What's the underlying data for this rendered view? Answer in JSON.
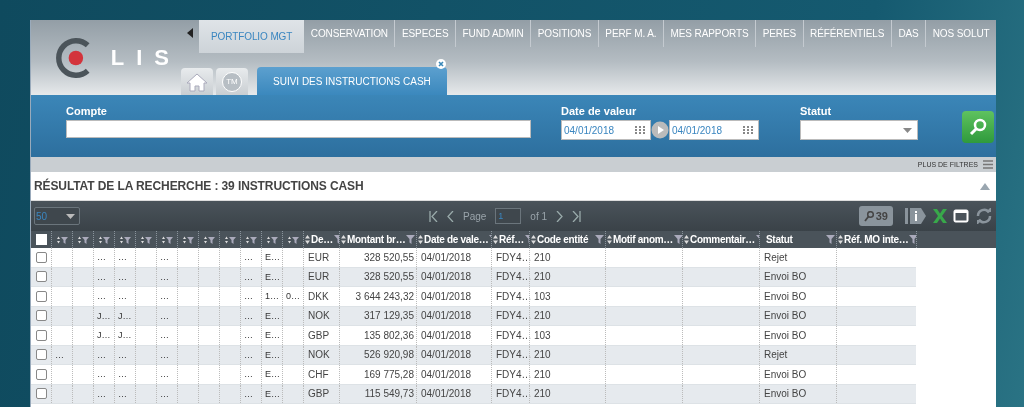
{
  "logo": "LIS",
  "nav": {
    "tabs": [
      {
        "label": "PORTFOLIO MGT",
        "selected": true
      },
      {
        "label": "CONSERVATION",
        "selected": false
      },
      {
        "label": "ESPECES",
        "selected": false
      },
      {
        "label": "FUND ADMIN",
        "selected": false
      },
      {
        "label": "POSITIONS",
        "selected": false
      },
      {
        "label": "PERF M. A.",
        "selected": false
      },
      {
        "label": "MES RAPPORTS",
        "selected": false
      },
      {
        "label": "PERES",
        "selected": false
      },
      {
        "label": "RÉFÉRENTIELS",
        "selected": false
      },
      {
        "label": "DAS",
        "selected": false
      },
      {
        "label": "NOS SOLUT",
        "selected": false
      }
    ]
  },
  "subtabs": [
    {
      "kind": "home",
      "selected": false
    },
    {
      "kind": "badge",
      "label": "TM",
      "selected": false
    },
    {
      "kind": "text",
      "label": "SUIVI DES INSTRUCTIONS CASH",
      "selected": true,
      "closable": true
    }
  ],
  "search_panel": {
    "fields": [
      {
        "kind": "text",
        "label": "Compte"
      },
      {
        "kind": "date_range",
        "label": "Date de valeur",
        "from": "04/01/2018",
        "to": "04/01/2018"
      },
      {
        "kind": "select",
        "label": "Statut"
      }
    ]
  },
  "filter_bar": {
    "link": "PLUS DE FILTRES"
  },
  "results": {
    "title": "RÉSULTAT DE LA RECHERCHE : 39 INSTRUCTIONS CASH"
  },
  "toolbar": {
    "page_size": "50",
    "page_label": "Page",
    "page": "1",
    "page_total": "of 1",
    "count": "39"
  },
  "table": {
    "header_checked": false,
    "columns": [
      {
        "kind": "mini"
      },
      {
        "kind": "mini"
      },
      {
        "kind": "mini"
      },
      {
        "kind": "mini"
      },
      {
        "kind": "mini"
      },
      {
        "kind": "mini"
      },
      {
        "kind": "mini"
      },
      {
        "kind": "mini"
      },
      {
        "kind": "mini"
      },
      {
        "kind": "mini"
      },
      {
        "kind": "mini"
      },
      {
        "kind": "mini"
      },
      {
        "kind": "text",
        "label": "De…",
        "sortable": true
      },
      {
        "kind": "number",
        "label": "Montant br…",
        "sortable": true
      },
      {
        "kind": "text",
        "label": "Date de vale…",
        "sortable": true
      },
      {
        "kind": "text",
        "label": "Réf…",
        "sortable": true
      },
      {
        "kind": "text",
        "label": "Code entité",
        "sortable": true
      },
      {
        "kind": "text",
        "label": "Motif anom…",
        "sortable": true
      },
      {
        "kind": "text",
        "label": "Commentair…",
        "sortable": true
      },
      {
        "kind": "text",
        "label": "Statut",
        "sortable": false
      },
      {
        "kind": "text",
        "label": "Réf. MO inte…",
        "sortable": true
      }
    ],
    "rows": [
      {
        "checked": false,
        "cells": [
          null,
          null,
          "…",
          "…",
          null,
          "…",
          null,
          null,
          null,
          "…",
          "E…",
          null,
          "EUR",
          "328 520,55",
          "04/01/2018",
          "FDY4…",
          "210",
          null,
          null,
          "Rejet",
          null
        ]
      },
      {
        "checked": false,
        "cells": [
          null,
          null,
          "…",
          "…",
          null,
          "…",
          null,
          null,
          null,
          "…",
          "E…",
          null,
          "EUR",
          "328 520,55",
          "04/01/2018",
          "FDY4…",
          "210",
          null,
          null,
          "Envoi BO",
          null
        ]
      },
      {
        "checked": false,
        "cells": [
          null,
          null,
          "…",
          "…",
          null,
          "…",
          null,
          null,
          null,
          "…",
          "1…",
          "0…",
          "DKK",
          "3 644 243,32",
          "04/01/2018",
          "FDY4…",
          "103",
          null,
          null,
          "Envoi BO",
          null
        ]
      },
      {
        "checked": false,
        "cells": [
          null,
          null,
          "J…",
          "J…",
          null,
          "…",
          null,
          null,
          null,
          "…",
          "E…",
          null,
          "NOK",
          "317 129,35",
          "04/01/2018",
          "FDY4…",
          "210",
          null,
          null,
          "Envoi BO",
          null
        ]
      },
      {
        "checked": false,
        "cells": [
          null,
          null,
          "J…",
          "J…",
          null,
          "…",
          null,
          null,
          null,
          "…",
          "E…",
          null,
          "GBP",
          "135 802,36",
          "04/01/2018",
          "FDY4…",
          "103",
          null,
          null,
          "Envoi BO",
          null
        ]
      },
      {
        "checked": false,
        "cells": [
          "…",
          null,
          "…",
          "…",
          null,
          "…",
          null,
          null,
          null,
          "…",
          "E…",
          null,
          "NOK",
          "526 920,98",
          "04/01/2018",
          "FDY4…",
          "210",
          null,
          null,
          "Rejet",
          null
        ]
      },
      {
        "checked": false,
        "cells": [
          null,
          null,
          "…",
          "…",
          null,
          "…",
          null,
          null,
          null,
          "…",
          "E…",
          null,
          "CHF",
          "169 775,28",
          "04/01/2018",
          "FDY4…",
          "210",
          null,
          null,
          "Envoi BO",
          null
        ]
      },
      {
        "checked": false,
        "cells": [
          null,
          null,
          "…",
          "…",
          null,
          "…",
          null,
          null,
          null,
          "…",
          "E…",
          null,
          "GBP",
          "115 549,73",
          "04/01/2018",
          "FDY4…",
          "210",
          null,
          null,
          "Envoi BO",
          null
        ]
      }
    ]
  }
}
